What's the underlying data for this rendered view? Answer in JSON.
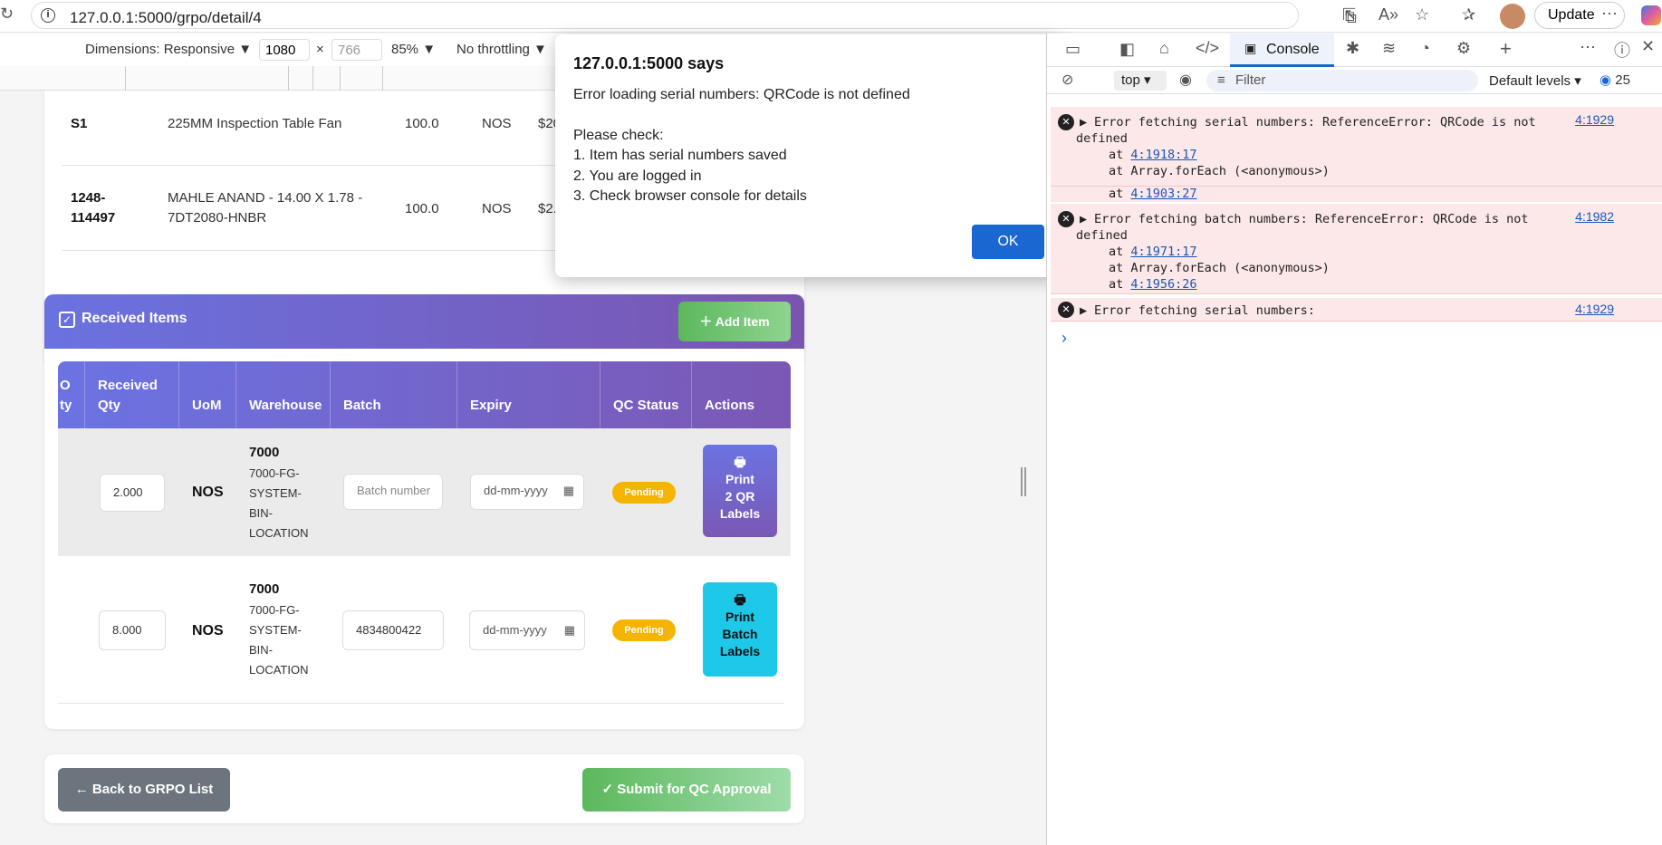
{
  "browser": {
    "url": "127.0.0.1:5000/grpo/detail/4",
    "update_label": "Update"
  },
  "devicebar": {
    "dimensions": "Dimensions: Responsive",
    "width": "1080",
    "height": "766",
    "zoom": "85%",
    "throttle": "No throttling"
  },
  "top_table": {
    "rows": [
      {
        "code": "S1",
        "desc": "225MM Inspection Table Fan",
        "qty": "100.0",
        "uom": "NOS",
        "price": "$20"
      },
      {
        "code": "1248-\n114497",
        "code1": "1248-",
        "code2": "114497",
        "desc1": "MAHLE ANAND - 14.00 X 1.78 -",
        "desc2": "7DT2080-HNBR",
        "qty": "100.0",
        "uom": "NOS",
        "price": "$2."
      }
    ]
  },
  "received": {
    "title": "Received Items",
    "add_label": "Add Item",
    "headers": {
      "po_qty1": "O",
      "po_qty2": "ty",
      "recv1": "Received",
      "recv2": "Qty",
      "uom": "UoM",
      "warehouse": "Warehouse",
      "batch": "Batch",
      "expiry": "Expiry",
      "qc": "QC Status",
      "actions": "Actions"
    },
    "rows": [
      {
        "qty": "2.000",
        "uom": "NOS",
        "wh": "7000",
        "loc1": "7000-FG-",
        "loc2": "SYSTEM-",
        "loc3": "BIN-",
        "loc4": "LOCATION",
        "batch_placeholder": "Batch number",
        "expiry": "dd-mm-yyyy",
        "status": "Pending",
        "btn1": "Print",
        "btn2": "2 QR",
        "btn3": "Labels"
      },
      {
        "qty": "8.000",
        "uom": "NOS",
        "wh": "7000",
        "loc1": "7000-FG-",
        "loc2": "SYSTEM-",
        "loc3": "BIN-",
        "loc4": "LOCATION",
        "batch": "4834800422",
        "expiry": "dd-mm-yyyy",
        "status": "Pending",
        "btn1": "Print",
        "btn2": "Batch",
        "btn3": "Labels"
      }
    ]
  },
  "footer": {
    "back_label": "Back to GRPO List",
    "submit_label": "Submit for QC Approval"
  },
  "dialog": {
    "title": "127.0.0.1:5000 says",
    "line1": "Error loading serial numbers: QRCode is not defined",
    "line2": "Please check:",
    "line3": "1. Item has serial numbers saved",
    "line4": "2. You are logged in",
    "line5": "3. Check browser console for details",
    "ok": "OK"
  },
  "devtools": {
    "console_tab": "Console",
    "context": "top",
    "filter": "Filter",
    "levels": "Default levels",
    "issues": "25",
    "errors": [
      {
        "l1": "Error fetching serial numbers: ReferenceError: QRCode is not",
        "l2": "defined",
        "at1": "4:1918:17",
        "at2": "Array.forEach (<anonymous>)",
        "at3": "4:1903:27",
        "link": "4:1929"
      },
      {
        "l1": "Error fetching batch numbers: ReferenceError: QRCode is not",
        "l2": "defined",
        "at1": "4:1971:17",
        "at2": "Array.forEach (<anonymous>)",
        "at3": "4:1956:26",
        "link": "4:1982"
      },
      {
        "l1": "Error fetching serial numbers:",
        "link": "4:1929"
      }
    ]
  },
  "colors": {
    "primary_gradient_start": "#6a72e0",
    "primary_gradient_end": "#7a55b0",
    "green": "#5cb85c",
    "cyan": "#1ec8e8",
    "pending": "#f4b400",
    "ok": "#1a67d2",
    "error_bg": "#fce8e8"
  }
}
